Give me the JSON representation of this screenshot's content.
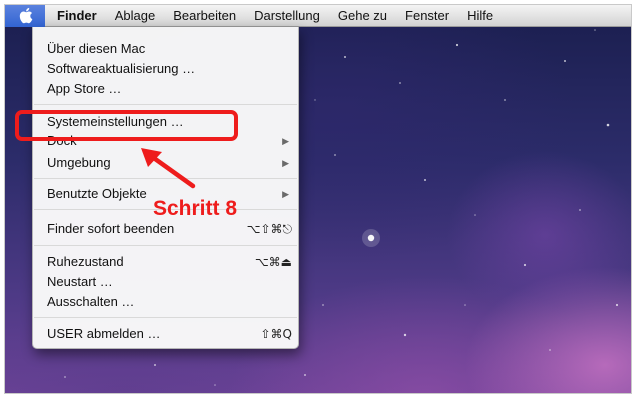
{
  "menubar": {
    "apple_icon": "apple-logo-icon",
    "items": [
      {
        "label": "Finder"
      },
      {
        "label": "Ablage"
      },
      {
        "label": "Bearbeiten"
      },
      {
        "label": "Darstellung"
      },
      {
        "label": "Gehe zu"
      },
      {
        "label": "Fenster"
      },
      {
        "label": "Hilfe"
      }
    ]
  },
  "apple_menu": {
    "items": [
      {
        "label": "Über diesen Mac"
      },
      {
        "label": "Softwareaktualisierung …"
      },
      {
        "label": "App Store …"
      },
      {
        "label": "Systemeinstellungen …"
      },
      {
        "label": "Dock",
        "submenu_icon": "submenu-arrow-icon"
      },
      {
        "label": "Umgebung",
        "submenu_icon": "submenu-arrow-icon"
      },
      {
        "label": "Benutzte Objekte",
        "submenu_icon": "submenu-arrow-icon"
      },
      {
        "label": "Finder sofort beenden",
        "shortcut": "⌥⇧⌘⎋"
      },
      {
        "label": "Ruhezustand",
        "shortcut": "⌥⌘⏏"
      },
      {
        "label": "Neustart …"
      },
      {
        "label": "Ausschalten …"
      },
      {
        "label": "USER abmelden …",
        "shortcut": "⇧⌘Q"
      }
    ]
  },
  "annotation": {
    "label": "Schritt 8",
    "color": "#ee1c1c"
  },
  "colors": {
    "menubar_highlight": "#3264d2",
    "desktop_base": "#2c2c6a"
  }
}
